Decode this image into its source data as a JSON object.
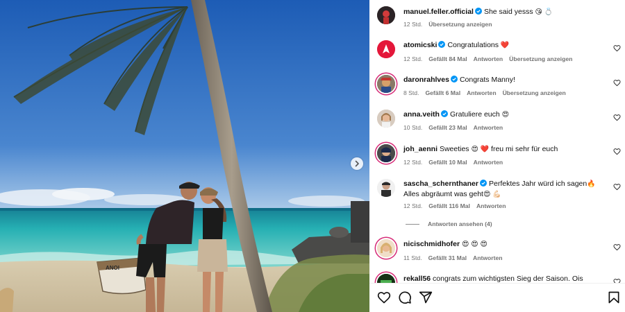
{
  "post": {
    "boat_text": "ANOI"
  },
  "comments": [
    {
      "username": "manuel.feller.official",
      "text": "She said yesss",
      "emoji": "😘 💍",
      "time": "12 Std.",
      "likes": "",
      "reply": "",
      "translate": "Übersetzung anzeigen",
      "liked": false
    },
    {
      "username": "atomicski",
      "text": "Congratulations",
      "emoji": "❤️",
      "time": "12 Std.",
      "likes": "Gefällt 84 Mal",
      "reply": "Antworten",
      "translate": "Übersetzung anzeigen"
    },
    {
      "username": "daronrahlves",
      "text": "Congrats Manny!",
      "emoji": "",
      "time": "8 Std.",
      "likes": "Gefällt 6 Mal",
      "reply": "Antworten",
      "translate": "Übersetzung anzeigen"
    },
    {
      "username": "anna.veith",
      "text": "Gratuliere euch",
      "emoji": "😍",
      "time": "10 Std.",
      "likes": "Gefällt 23 Mal",
      "reply": "Antworten",
      "translate": ""
    },
    {
      "username": "joh_aenni",
      "text": "Sweeties",
      "emoji": "😍 ❤️",
      "text2": "freu mi sehr für euch",
      "time": "12 Std.",
      "likes": "Gefällt 10 Mal",
      "reply": "Antworten",
      "translate": ""
    },
    {
      "username": "sascha_schernthaner",
      "text": "Perfektes Jahr würd ich sagen",
      "emoji": "🔥",
      "text2": "Alles abgräumt was geht",
      "emoji2": "😍 💪🏻",
      "time": "12 Std.",
      "likes": "Gefällt 116 Mal",
      "reply": "Antworten",
      "translate": ""
    },
    {
      "username": "nicischmidhofer",
      "text": "",
      "emoji": "😍 😍 😍",
      "time": "11 Std.",
      "likes": "Gefällt 31 Mal",
      "reply": "Antworten",
      "translate": ""
    },
    {
      "username": "rekall56",
      "text": "congrats zum wichtigsten Sieg der Saison. Ois guade",
      "emoji": "",
      "time": "",
      "likes": "",
      "reply": "",
      "translate": ""
    }
  ],
  "replies_link": "Antworten ansehen (4)",
  "icons": {
    "like": "heart-icon",
    "comment": "comment-icon",
    "share": "share-icon",
    "save": "bookmark-icon",
    "verified": "verified-badge-icon",
    "next": "chevron-right-icon"
  },
  "colors": {
    "verified": "#0095f6",
    "heart_red": "#ed4956",
    "meta_gray": "#737373",
    "sky": "#2b66b3",
    "sea": "#2fb7b0"
  }
}
